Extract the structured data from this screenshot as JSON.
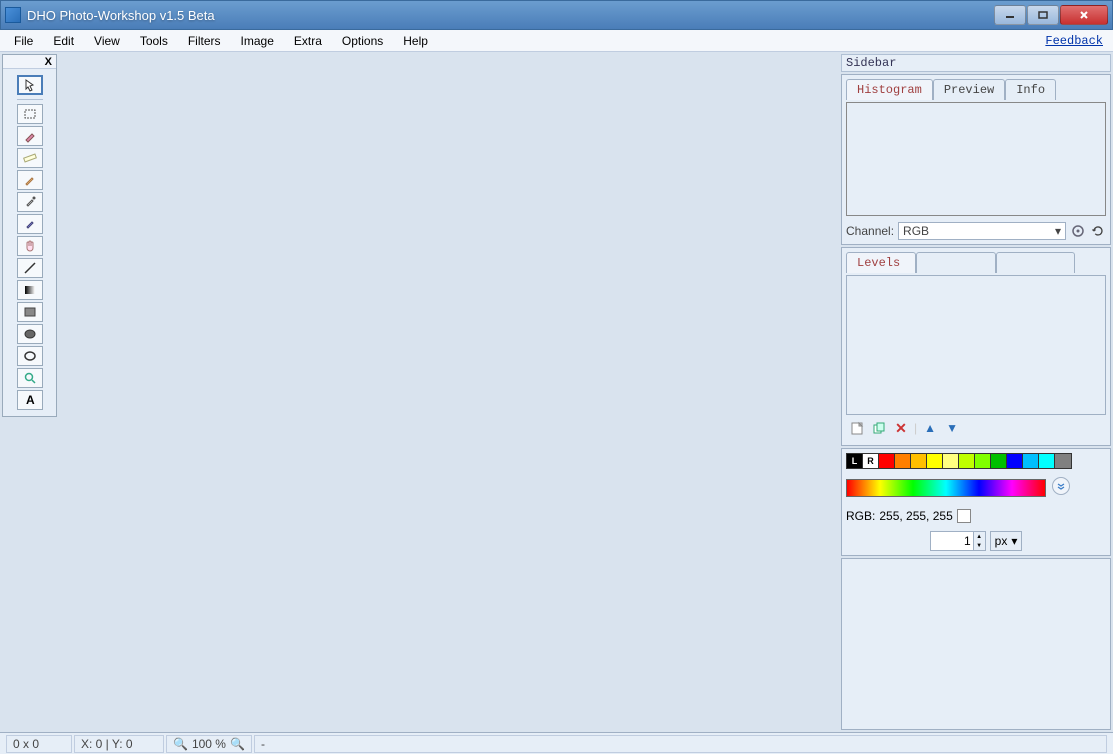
{
  "window": {
    "title": "DHO Photo-Workshop v1.5 Beta"
  },
  "menubar": {
    "items": [
      "File",
      "Edit",
      "View",
      "Tools",
      "Filters",
      "Image",
      "Extra",
      "Options",
      "Help"
    ],
    "feedback": "Feedback"
  },
  "toolbox": {
    "close": "X",
    "tools": [
      {
        "name": "pointer",
        "selected": true
      },
      {
        "name": "marquee"
      },
      {
        "name": "brush"
      },
      {
        "name": "ruler"
      },
      {
        "name": "pencil"
      },
      {
        "name": "eyedropper"
      },
      {
        "name": "picker"
      },
      {
        "name": "hand"
      },
      {
        "name": "line"
      },
      {
        "name": "gradient"
      },
      {
        "name": "rectangle"
      },
      {
        "name": "ellipse-filled"
      },
      {
        "name": "ellipse-outline"
      },
      {
        "name": "zoom"
      },
      {
        "name": "text"
      }
    ]
  },
  "sidebar": {
    "title": "Sidebar",
    "histogram": {
      "tabs": [
        "Histogram",
        "Preview",
        "Info"
      ],
      "active_tab": 0,
      "channel_label": "Channel:",
      "channel_value": "RGB"
    },
    "levels": {
      "tabs": [
        "Levels",
        "",
        ""
      ]
    },
    "color": {
      "swatches": [
        {
          "label": "L",
          "bg": "#000",
          "fg": "#fff"
        },
        {
          "label": "R",
          "bg": "#fff",
          "fg": "#000"
        },
        {
          "label": "",
          "bg": "#ff0000"
        },
        {
          "label": "",
          "bg": "#ff7f00"
        },
        {
          "label": "",
          "bg": "#ffbf00"
        },
        {
          "label": "",
          "bg": "#ffff00"
        },
        {
          "label": "",
          "bg": "#ffff80"
        },
        {
          "label": "",
          "bg": "#bfff00"
        },
        {
          "label": "",
          "bg": "#80ff00"
        },
        {
          "label": "",
          "bg": "#00c000"
        },
        {
          "label": "",
          "bg": "#0000ff"
        },
        {
          "label": "",
          "bg": "#00bfff"
        },
        {
          "label": "",
          "bg": "#00ffff"
        },
        {
          "label": "",
          "bg": "#808080"
        }
      ],
      "rgb_label": "RGB:",
      "rgb_value": "255, 255, 255",
      "size_value": "1",
      "size_unit": "px"
    }
  },
  "statusbar": {
    "dimensions": "0 x 0",
    "coords": "X: 0 | Y: 0",
    "zoom": "100  %",
    "extra": "-"
  }
}
